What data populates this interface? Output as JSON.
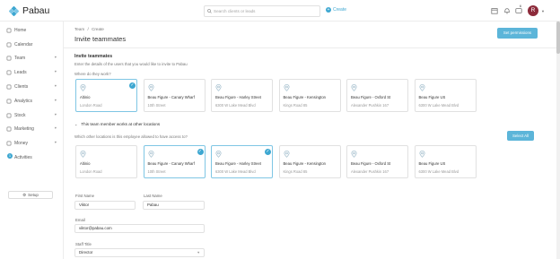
{
  "app": {
    "name": "Pabau"
  },
  "topbar": {
    "search_placeholder": "Search clients or leads",
    "create_label": "Create",
    "avatar_initial": "R",
    "notification_count": "6"
  },
  "sidebar": {
    "items": [
      {
        "label": "Home",
        "icon": "home-icon"
      },
      {
        "label": "Calendar",
        "icon": "calendar-icon"
      },
      {
        "label": "Team",
        "icon": "team-icon",
        "expandable": true
      },
      {
        "label": "Leads",
        "icon": "leads-icon",
        "expandable": true
      },
      {
        "label": "Clients",
        "icon": "clients-icon",
        "expandable": true
      },
      {
        "label": "Analytics",
        "icon": "analytics-icon",
        "expandable": true
      },
      {
        "label": "Stock",
        "icon": "stock-icon",
        "expandable": true
      },
      {
        "label": "Marketing",
        "icon": "marketing-icon",
        "expandable": true
      },
      {
        "label": "Money",
        "icon": "money-icon",
        "expandable": true
      },
      {
        "label": "Activities",
        "icon": "activities-icon",
        "badge": "1"
      }
    ],
    "setup_label": "Setup"
  },
  "header": {
    "breadcrumb": {
      "parent": "Team",
      "separator": "/",
      "current": "Create"
    },
    "title": "Invite teammates",
    "set_permissions_label": "Set permissions"
  },
  "section": {
    "title": "Invite teammates",
    "description": "Enter the details of the users that you would like to invite to Pabau",
    "where_label": "Where do they work?",
    "other_locations_toggle": "This team member works at other locations",
    "other_locations_question": "Which other locations is this employee allowed to have access to?",
    "select_all_label": "Select All"
  },
  "locations": [
    {
      "name": "Altinio",
      "address": "London Road"
    },
    {
      "name": "Beau Figure - Canary Wharf",
      "address": "10th Street"
    },
    {
      "name": "Beau Figure - Harley Street",
      "address": "6300 W Lake Mead Blvd"
    },
    {
      "name": "Beau Figure - Kensington",
      "address": "Kings Road 85"
    },
    {
      "name": "Beau Figure - Oxford St",
      "address": "Alexander Pushkin 167"
    },
    {
      "name": "Beau Figure US",
      "address": "6300 W Lake Mead Blvd"
    }
  ],
  "primary_selected": [
    true,
    false,
    false,
    false,
    false,
    false
  ],
  "other_selected": [
    false,
    true,
    true,
    false,
    false,
    false
  ],
  "form": {
    "first_name": {
      "label": "First Name",
      "value": "Viktor"
    },
    "last_name": {
      "label": "Last Name",
      "value": "Pabau"
    },
    "email": {
      "label": "Email",
      "value": "viktor@pabau.com"
    },
    "staff_title": {
      "label": "Staff Title",
      "value": "Director"
    }
  },
  "colors": {
    "accent": "#3da7d1",
    "button": "#5cb5d9",
    "avatar": "#8c2a3a"
  }
}
